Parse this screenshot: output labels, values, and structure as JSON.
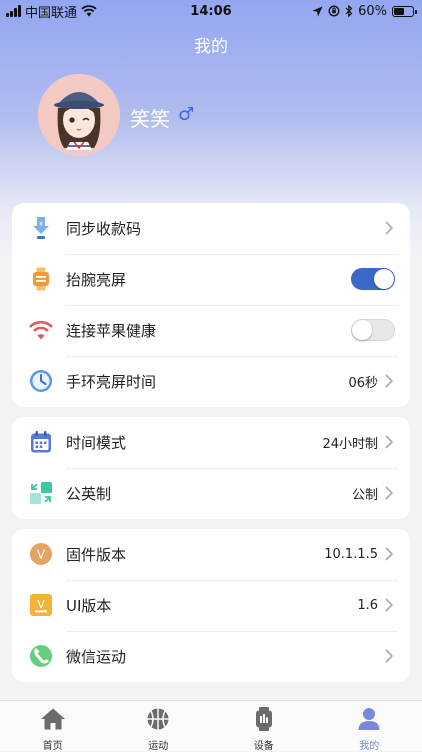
{
  "status_bar": {
    "carrier": "中国联通",
    "time": "14:06",
    "battery": "60%",
    "battery_level": 0.6
  },
  "header": {
    "title": "我的"
  },
  "profile": {
    "name": "笑笑",
    "gender_symbol": "♂"
  },
  "settings": {
    "group1": [
      {
        "label": "同步收款码",
        "icon": "sync-qrcode-icon"
      },
      {
        "label": "抬腕亮屏",
        "icon": "watch-icon",
        "toggle": true
      },
      {
        "label": "连接苹果健康",
        "icon": "wifi-health-icon",
        "toggle": false
      },
      {
        "label": "手环亮屏时间",
        "value": "06秒",
        "icon": "clock-icon"
      }
    ],
    "group2": [
      {
        "label": "时间模式",
        "value": "24小时制",
        "icon": "calendar-icon"
      },
      {
        "label": "公英制",
        "value": "公制",
        "icon": "unit-convert-icon"
      }
    ],
    "group3": [
      {
        "label": "固件版本",
        "value": "10.1.1.5",
        "icon": "firmware-version-icon",
        "badge": "V"
      },
      {
        "label": "UI版本",
        "value": "1.6",
        "icon": "ui-version-icon",
        "badge": "V"
      },
      {
        "label": "微信运动",
        "icon": "wechat-sport-icon"
      }
    ]
  },
  "tabbar": {
    "tabs": [
      {
        "label": "首页",
        "icon": "home-icon"
      },
      {
        "label": "运动",
        "icon": "basketball-icon"
      },
      {
        "label": "设备",
        "icon": "device-icon"
      },
      {
        "label": "我的",
        "icon": "user-icon",
        "active": true
      }
    ]
  },
  "colors": {
    "accent": "#3b68c9",
    "header_gradient_top": "#93a6f0",
    "tab_active": "#7a88d8",
    "gender": "#3c69e0"
  }
}
